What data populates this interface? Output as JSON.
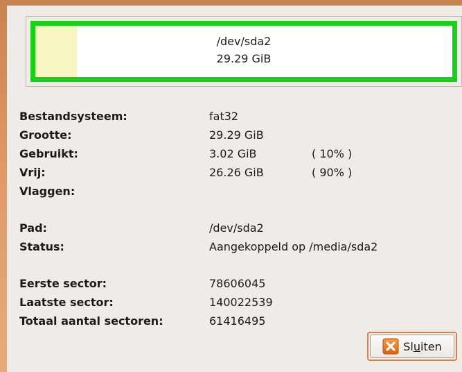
{
  "partition": {
    "path": "/dev/sda2",
    "size": "29.29 GiB",
    "used_fraction": 0.1
  },
  "info": {
    "filesystem_label": "Bestandsysteem:",
    "filesystem_value": "fat32",
    "size_label": "Grootte:",
    "size_value": "29.29 GiB",
    "used_label": "Gebruikt:",
    "used_value": "3.02 GiB",
    "used_percent": "( 10% )",
    "free_label": "Vrij:",
    "free_value": "26.26 GiB",
    "free_percent": "( 90% )",
    "flags_label": "Vlaggen:",
    "flags_value": "",
    "path_label": "Pad:",
    "path_value": "/dev/sda2",
    "status_label": "Status:",
    "status_value": "Aangekoppeld op /media/sda2",
    "first_sector_label": "Eerste sector:",
    "first_sector_value": "78606045",
    "last_sector_label": "Laatste sector:",
    "last_sector_value": "140022539",
    "total_sectors_label": "Totaal aantal sectoren:",
    "total_sectors_value": "61416495"
  },
  "close_button": {
    "label_pre": "Sl",
    "label_mnemonic": "u",
    "label_post": "iten",
    "icon": "close-icon"
  },
  "colors": {
    "partition_border": "#18d018",
    "used_fill": "#f7f5c0",
    "close_icon": "#f07a1e"
  }
}
